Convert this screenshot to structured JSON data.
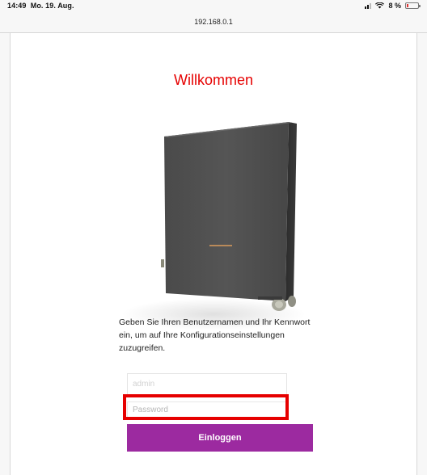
{
  "status_bar": {
    "time": "14:49",
    "date": "Mo. 19. Aug.",
    "battery": "8 %"
  },
  "browser": {
    "address": "192.168.0.1"
  },
  "login": {
    "title": "Willkommen",
    "instructions": "Geben Sie Ihren Benutzernamen und Ihr Kennwort ein, um auf Ihre Konfigurationseinstellungen zuzugreifen.",
    "username_placeholder": "admin",
    "password_placeholder": "Password",
    "login_button": "Einloggen"
  },
  "colors": {
    "accent_red": "#e60000",
    "button_purple": "#9c2aa0"
  },
  "icons": [
    "signal-icon",
    "wifi-icon",
    "battery-icon"
  ]
}
